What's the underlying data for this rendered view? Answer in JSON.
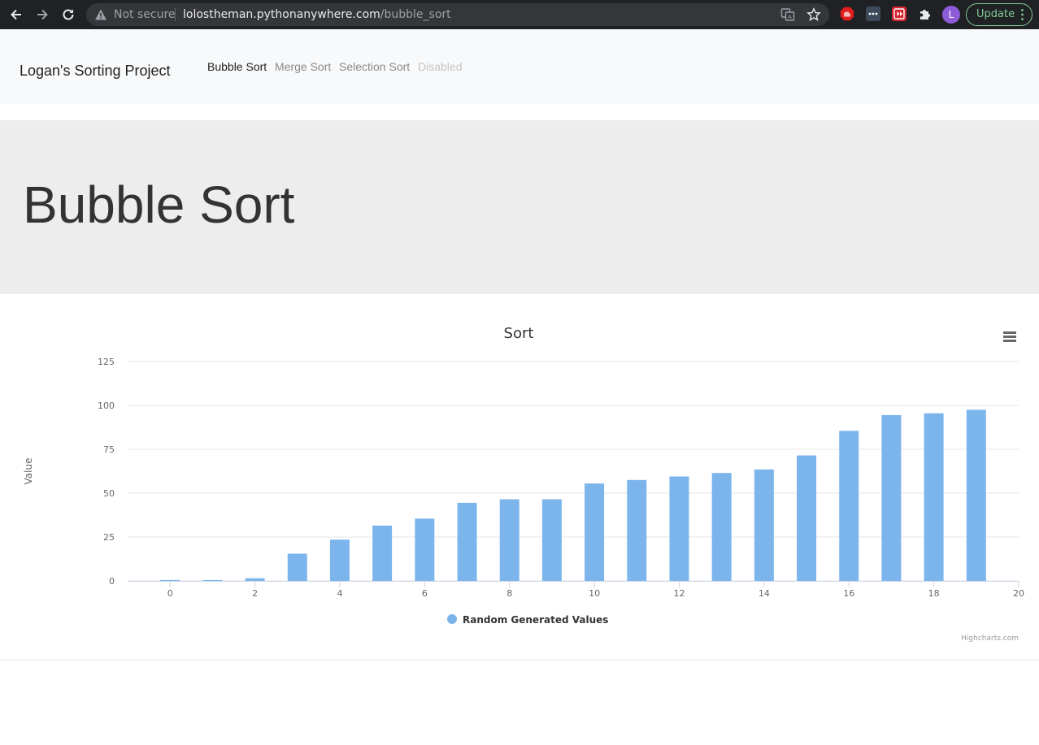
{
  "browser": {
    "not_secure_label": "Not secure",
    "url_host": "lolostheman.pythonanywhere.com",
    "url_path": "/bubble_sort",
    "profile_initial": "L",
    "update_label": "Update"
  },
  "navbar": {
    "brand": "Logan's Sorting Project",
    "links": [
      {
        "label": "Bubble Sort",
        "state": "active"
      },
      {
        "label": "Merge Sort",
        "state": "normal"
      },
      {
        "label": "Selection Sort",
        "state": "normal"
      },
      {
        "label": "Disabled",
        "state": "disabled"
      }
    ]
  },
  "page": {
    "title": "Bubble Sort"
  },
  "chart_data": {
    "type": "bar",
    "title": "Sort",
    "ylabel": "Value",
    "xlabel": "",
    "ylim": [
      0,
      125
    ],
    "yticks": [
      0,
      25,
      50,
      75,
      100,
      125
    ],
    "xlim": [
      -1,
      20
    ],
    "xticks": [
      0,
      2,
      4,
      6,
      8,
      10,
      12,
      14,
      16,
      18,
      20
    ],
    "grid": true,
    "legend_position": "bottom-center",
    "credits": "Highcharts.com",
    "series": [
      {
        "name": "Random Generated Values",
        "color": "#7cb5ec",
        "x": [
          0,
          1,
          2,
          3,
          4,
          5,
          6,
          7,
          8,
          9,
          10,
          11,
          12,
          13,
          14,
          15,
          16,
          17,
          18,
          19
        ],
        "values": [
          0.5,
          0.5,
          1.5,
          15.5,
          23.5,
          31.5,
          35.5,
          44.5,
          46.5,
          46.5,
          55.5,
          57.5,
          59.5,
          61.5,
          63.5,
          71.5,
          85.5,
          94.5,
          95.5,
          97.5
        ]
      }
    ]
  }
}
